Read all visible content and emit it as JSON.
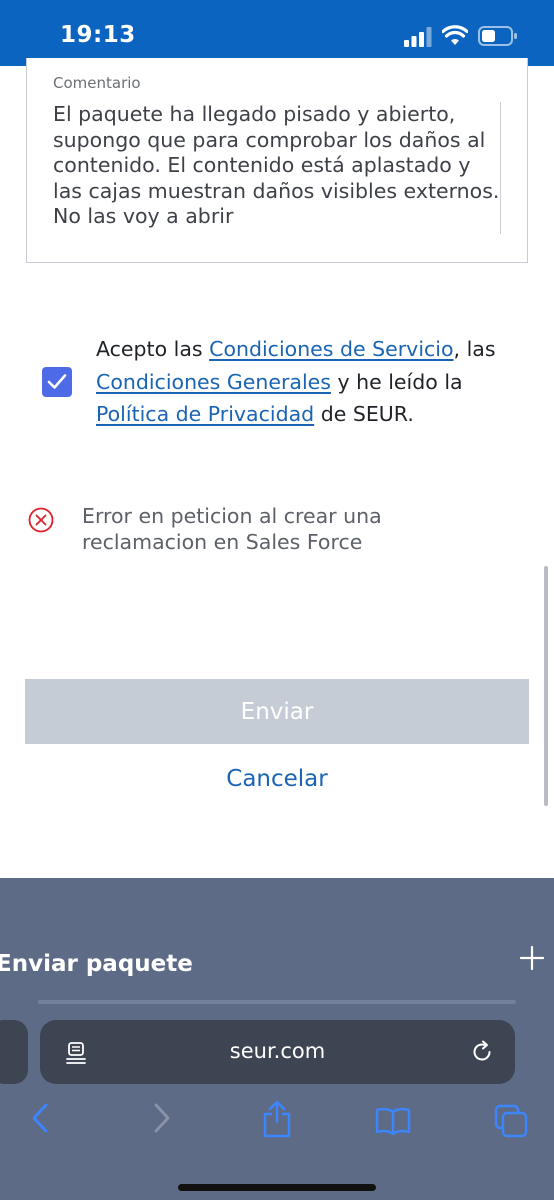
{
  "status_bar": {
    "time": "19:13",
    "icons": [
      "signal-icon",
      "wifi-icon",
      "battery-icon"
    ],
    "background": "#0b65c0"
  },
  "comment": {
    "label": "Comentario",
    "text": "El paquete ha llegado pisado y abierto, supongo que para comprobar los daños al contenido. El contenido está aplastado y las cajas muestran daños visibles externos. No las voy a abrir"
  },
  "terms": {
    "checked": true,
    "part1": "Acepto las ",
    "link1": "Condiciones de Servicio",
    "part2": ", las ",
    "link2": "Condiciones Generales",
    "part3": " y he leído la ",
    "link3": "Política de Privacidad",
    "part4": " de SEUR.",
    "checkbox_color": "#4d6be6",
    "link_color": "#1b64b4"
  },
  "error": {
    "icon": "error-circle-icon",
    "message": "Error en peticion al crear una reclamacion en Sales Force",
    "color": "#e0202a"
  },
  "actions": {
    "send_label": "Enviar",
    "cancel_label": "Cancelar",
    "send_disabled_color": "#c6ccd5"
  },
  "browser": {
    "tab_title": "Enviar paquete",
    "url": "seur.com",
    "toolbar": [
      "back-icon",
      "forward-icon",
      "share-icon",
      "bookmarks-icon",
      "tabs-icon"
    ],
    "background": "#5e6b87"
  }
}
